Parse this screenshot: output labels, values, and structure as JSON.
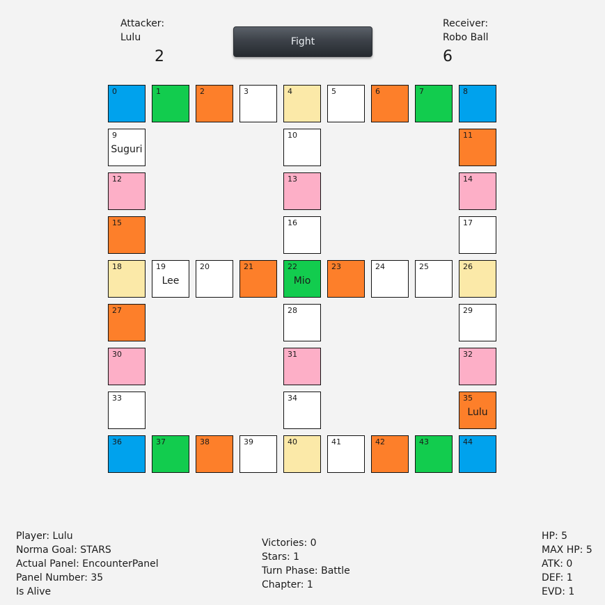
{
  "header": {
    "attacker_label": "Attacker:",
    "attacker_name": "Lulu",
    "attacker_roll": "2",
    "fight_label": "Fight",
    "receiver_label": "Receiver:",
    "receiver_name": "Robo Ball",
    "receiver_roll": "6"
  },
  "colors": {
    "blue": "#00a2ed",
    "green": "#12cc4e",
    "orange": "#fd7f2a",
    "white": "#ffffff",
    "yellow": "#fbe9a8",
    "pink": "#fdafc7"
  },
  "board": {
    "panels": [
      {
        "number": "0",
        "color": "blue",
        "occupant": ""
      },
      {
        "number": "1",
        "color": "green",
        "occupant": ""
      },
      {
        "number": "2",
        "color": "orange",
        "occupant": ""
      },
      {
        "number": "3",
        "color": "white",
        "occupant": ""
      },
      {
        "number": "4",
        "color": "yellow",
        "occupant": ""
      },
      {
        "number": "5",
        "color": "white",
        "occupant": ""
      },
      {
        "number": "6",
        "color": "orange",
        "occupant": ""
      },
      {
        "number": "7",
        "color": "green",
        "occupant": ""
      },
      {
        "number": "8",
        "color": "blue",
        "occupant": ""
      },
      {
        "number": "9",
        "color": "white",
        "occupant": "Suguri"
      },
      {
        "number": "10",
        "color": "white",
        "occupant": ""
      },
      {
        "number": "11",
        "color": "orange",
        "occupant": ""
      },
      {
        "number": "12",
        "color": "pink",
        "occupant": ""
      },
      {
        "number": "13",
        "color": "pink",
        "occupant": ""
      },
      {
        "number": "14",
        "color": "pink",
        "occupant": ""
      },
      {
        "number": "15",
        "color": "orange",
        "occupant": ""
      },
      {
        "number": "16",
        "color": "white",
        "occupant": ""
      },
      {
        "number": "17",
        "color": "white",
        "occupant": ""
      },
      {
        "number": "18",
        "color": "yellow",
        "occupant": ""
      },
      {
        "number": "19",
        "color": "white",
        "occupant": "Lee"
      },
      {
        "number": "20",
        "color": "white",
        "occupant": ""
      },
      {
        "number": "21",
        "color": "orange",
        "occupant": ""
      },
      {
        "number": "22",
        "color": "green",
        "occupant": "Mio"
      },
      {
        "number": "23",
        "color": "orange",
        "occupant": ""
      },
      {
        "number": "24",
        "color": "white",
        "occupant": ""
      },
      {
        "number": "25",
        "color": "white",
        "occupant": ""
      },
      {
        "number": "26",
        "color": "yellow",
        "occupant": ""
      },
      {
        "number": "27",
        "color": "orange",
        "occupant": ""
      },
      {
        "number": "28",
        "color": "white",
        "occupant": ""
      },
      {
        "number": "29",
        "color": "white",
        "occupant": ""
      },
      {
        "number": "30",
        "color": "pink",
        "occupant": ""
      },
      {
        "number": "31",
        "color": "pink",
        "occupant": ""
      },
      {
        "number": "32",
        "color": "pink",
        "occupant": ""
      },
      {
        "number": "33",
        "color": "white",
        "occupant": ""
      },
      {
        "number": "34",
        "color": "white",
        "occupant": ""
      },
      {
        "number": "35",
        "color": "orange",
        "occupant": "Lulu"
      },
      {
        "number": "36",
        "color": "blue",
        "occupant": ""
      },
      {
        "number": "37",
        "color": "green",
        "occupant": ""
      },
      {
        "number": "38",
        "color": "orange",
        "occupant": ""
      },
      {
        "number": "39",
        "color": "white",
        "occupant": ""
      },
      {
        "number": "40",
        "color": "yellow",
        "occupant": ""
      },
      {
        "number": "41",
        "color": "white",
        "occupant": ""
      },
      {
        "number": "42",
        "color": "orange",
        "occupant": ""
      },
      {
        "number": "43",
        "color": "green",
        "occupant": ""
      },
      {
        "number": "44",
        "color": "blue",
        "occupant": ""
      }
    ]
  },
  "status": {
    "left": [
      "Player: Lulu",
      "Norma Goal: STARS",
      "Actual Panel: EncounterPanel",
      "Panel Number: 35",
      "Is Alive"
    ],
    "center": [
      "Victories: 0",
      "Stars: 1",
      "Turn Phase: Battle",
      "Chapter: 1"
    ],
    "right": [
      "HP: 5",
      "MAX HP: 5",
      "ATK: 0",
      "DEF: 1",
      "EVD: 1"
    ]
  }
}
